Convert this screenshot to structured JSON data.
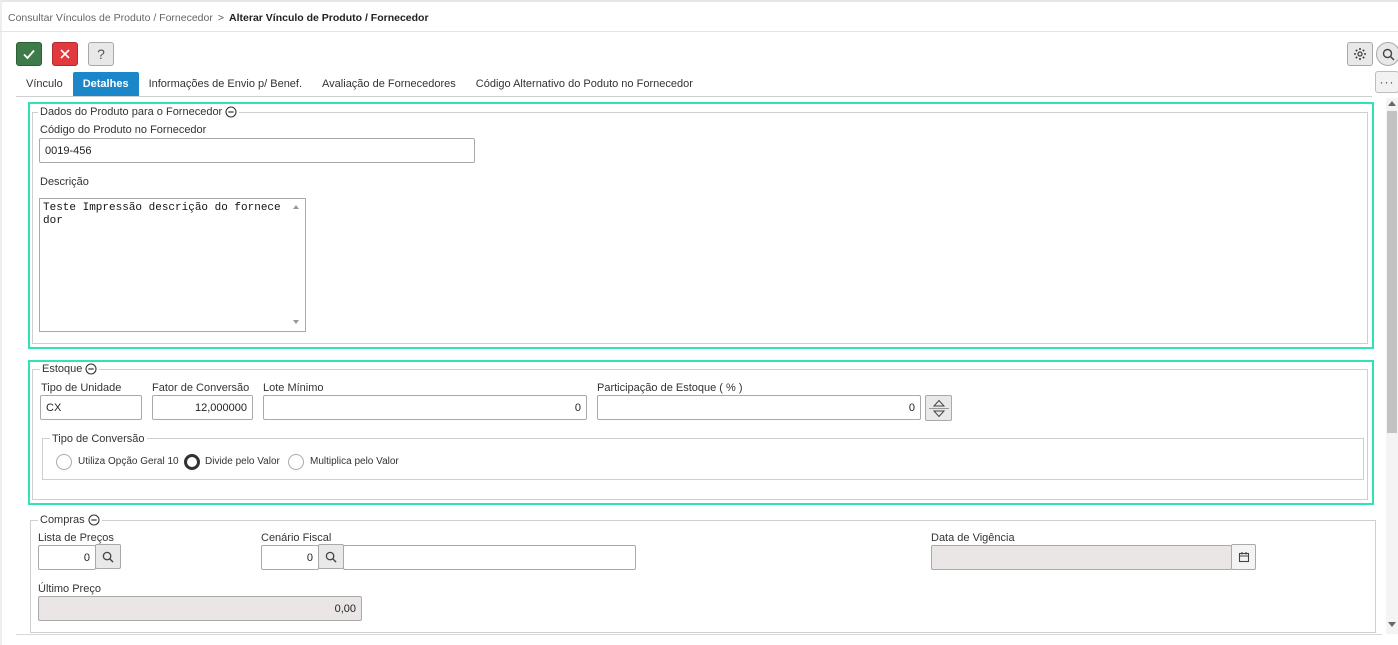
{
  "breadcrumb": {
    "parent": "Consultar Vínculos de Produto / Fornecedor",
    "separator": ">",
    "current": "Alterar Vínculo de Produto / Fornecedor"
  },
  "toolbar": {
    "help_label": "?",
    "more_label": "···"
  },
  "tabs": [
    {
      "label": "Vínculo",
      "active": false
    },
    {
      "label": "Detalhes",
      "active": true
    },
    {
      "label": "Informações de Envio p/ Benef.",
      "active": false
    },
    {
      "label": "Avaliação de Fornecedores",
      "active": false
    },
    {
      "label": "Código Alternativo do Poduto no Fornecedor",
      "active": false
    }
  ],
  "dados_produto": {
    "legend": "Dados do Produto para o Fornecedor",
    "codigo_label": "Código do Produto no Fornecedor",
    "codigo_value": "0019-456",
    "descricao_label": "Descrição",
    "descricao_value": "Teste Impressão descrição do fornecedor"
  },
  "estoque": {
    "legend": "Estoque",
    "tipo_unidade_label": "Tipo de Unidade",
    "tipo_unidade_value": "CX",
    "fator_label": "Fator de Conversão",
    "fator_value": "12,000000",
    "lote_label": "Lote Mínimo",
    "lote_value": "0",
    "participacao_label": "Participação de Estoque ( % )",
    "participacao_value": "0",
    "tipo_conversao": {
      "legend": "Tipo de Conversão",
      "options": [
        {
          "label": "Utiliza Opção Geral 10",
          "checked": false
        },
        {
          "label": "Divide pelo Valor",
          "checked": true
        },
        {
          "label": "Multiplica pelo Valor",
          "checked": false
        }
      ]
    }
  },
  "compras": {
    "legend": "Compras",
    "lista_label": "Lista de Preços",
    "lista_value": "0",
    "cenario_label": "Cenário Fiscal",
    "cenario_value": "0",
    "cenario_desc": "",
    "data_vigencia_label": "Data de Vigência",
    "data_vigencia_value": "",
    "ultimo_preco_label": "Último Preço",
    "ultimo_preco_value": "0,00"
  },
  "colors": {
    "accent_tab": "#1b87c9",
    "confirm": "#3d7c4a",
    "cancel": "#e0393e",
    "highlight_border": "#30e3b4",
    "readonly_bg": "#ebe6e6"
  },
  "icons": [
    "check-icon",
    "close-icon",
    "help-icon",
    "gear-icon",
    "search-icon",
    "more-icon",
    "collapse-icon",
    "calendar-icon",
    "spinner-up-icon",
    "spinner-down-icon"
  ]
}
